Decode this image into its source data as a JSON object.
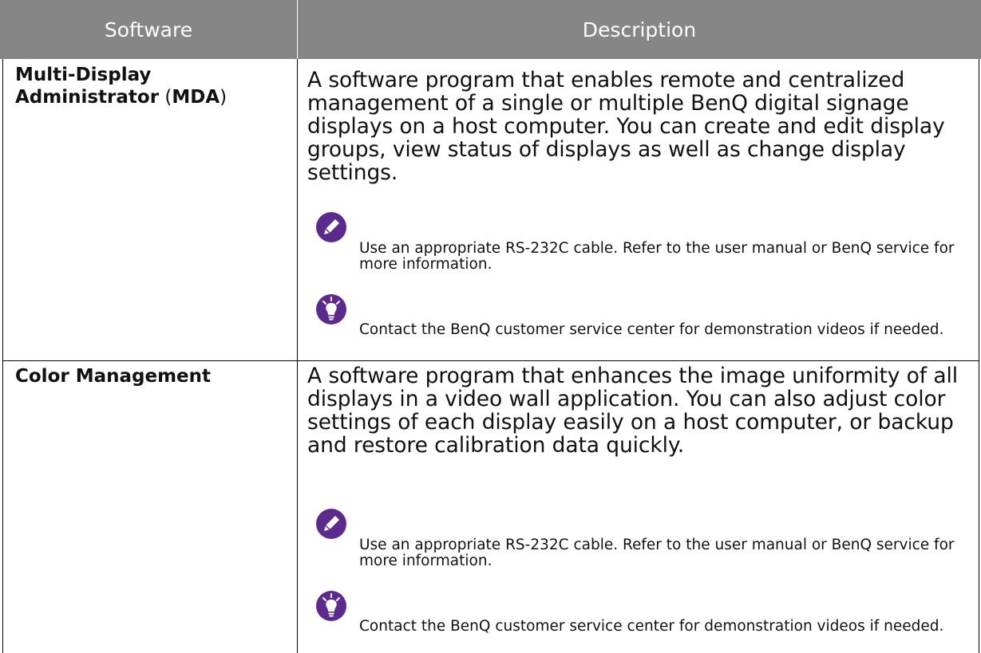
{
  "header": {
    "software": "Software",
    "description": "Description"
  },
  "rows": [
    {
      "name_line1": "Multi-Display",
      "name_line2_bold": "Administrator",
      "name_paren_open": " (",
      "name_abbr": "MDA",
      "name_paren_close": ")",
      "description": "A software program that enables remote and centralized management of a single or multiple BenQ digital signage displays on a host computer. You can create and edit display groups, view status of displays as well as change display settings.",
      "note": {
        "icon": "pencil-icon",
        "text": "Use an appropriate RS-232C cable. Refer to the user manual or BenQ service for more information."
      },
      "tip": {
        "icon": "lightbulb-icon",
        "text": "Contact the BenQ customer service center for demonstration videos if needed."
      }
    },
    {
      "name": "Color Management",
      "description": "A software program that enhances the image uniformity of all displays in a video wall application. You can also adjust color settings of each display easily on a host computer, or backup and restore calibration data quickly.",
      "note": {
        "icon": "pencil-icon",
        "text": "Use an appropriate RS-232C cable. Refer to the user manual or BenQ service for more information."
      },
      "tip": {
        "icon": "lightbulb-icon",
        "text": "Contact the BenQ customer service center for demonstration videos if needed."
      }
    }
  ],
  "colors": {
    "header_bg": "#868686",
    "header_text": "#ffffff",
    "icon_purple": "#5b2a8c"
  }
}
